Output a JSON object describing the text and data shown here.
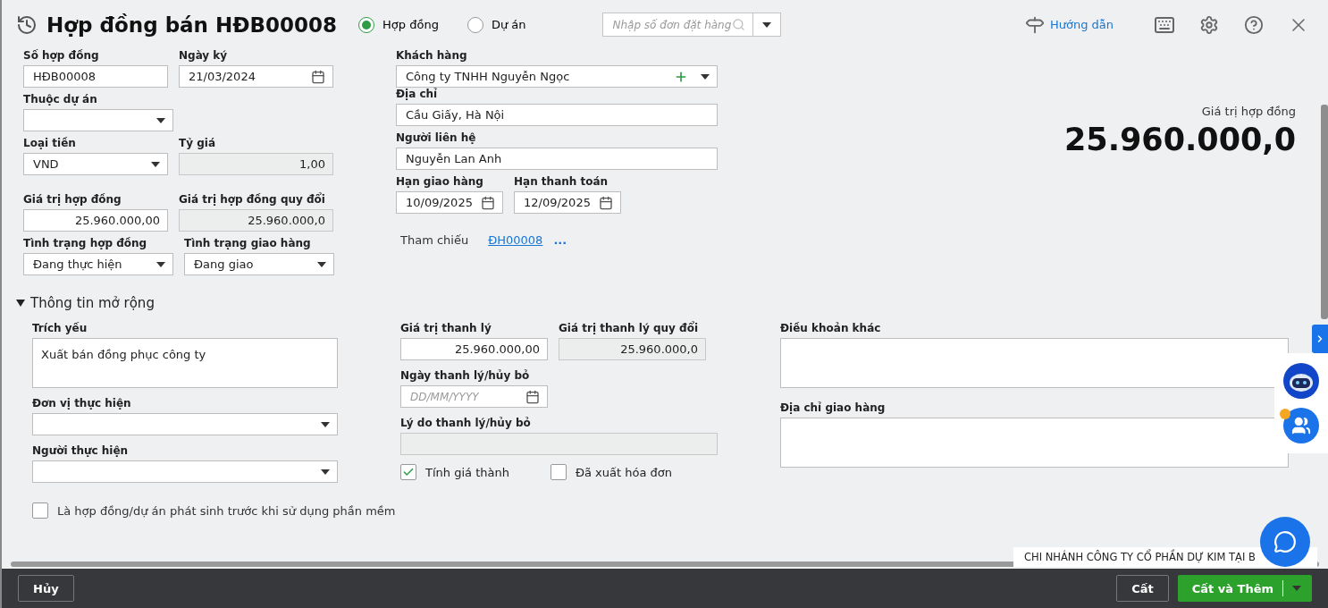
{
  "header": {
    "title": "Hợp đồng bán HĐB00008",
    "modes": [
      {
        "label": "Hợp đồng",
        "selected": true
      },
      {
        "label": "Dự án",
        "selected": false
      }
    ],
    "order_search": {
      "placeholder": "Nhập số đơn đặt hàng"
    },
    "guide_link": "Hướng dẫn"
  },
  "main_left": [
    [
      {
        "label": "Số hợp đồng",
        "value": "HĐB00008",
        "kind": "text"
      },
      {
        "label": "Ngày ký",
        "value": "21/03/2024",
        "kind": "date"
      }
    ],
    [
      {
        "label": "Thuộc dự án",
        "kind": "select"
      }
    ],
    [
      {
        "label": "Loại tiền",
        "value": "VND",
        "kind": "select"
      },
      {
        "label": "Tỷ giá",
        "value": "1,00",
        "kind": "readonly"
      }
    ],
    [
      {
        "label": "Giá trị hợp đồng",
        "value": "25.960.000,00",
        "kind": "number"
      },
      {
        "label": "Giá trị hợp đồng quy đổi",
        "value": "25.960.000,0",
        "kind": "readonly"
      }
    ],
    [
      {
        "label": "Tình trạng hợp đồng",
        "value": "Đang thực hiện",
        "kind": "select"
      },
      {
        "label": "Tình trạng giao hàng",
        "value": "Đang giao",
        "kind": "select"
      }
    ]
  ],
  "main_middle": [
    [
      {
        "label": "Khách hàng",
        "value": "Công ty TNHH Nguyễn Ngọc",
        "kind": "lookup"
      }
    ],
    [
      {
        "label": "Địa chỉ",
        "value": "Cầu Giấy, Hà Nội",
        "kind": "text"
      }
    ],
    [
      {
        "label": "Người liên hệ",
        "value": "Nguyễn Lan Anh",
        "kind": "text"
      }
    ],
    [
      {
        "label": "Hạn giao hàng",
        "value": "10/09/2025",
        "kind": "date"
      },
      {
        "label": "Hạn thanh toán",
        "value": "12/09/2025",
        "kind": "date"
      }
    ]
  ],
  "reference": {
    "label": "Tham chiếu",
    "link": "ĐH00008",
    "more": "..."
  },
  "total": {
    "label": "Giá trị hợp đồng",
    "value": "25.960.000,0"
  },
  "extended": {
    "title": "Thông tin mở rộng",
    "expanded": true,
    "left": [
      {
        "label": "Trích yếu",
        "value": "Xuất bán đồng phục công ty",
        "kind": "textarea"
      },
      {
        "label": "Đơn vị thực hiện",
        "kind": "select"
      },
      {
        "label": "Người thực hiện",
        "kind": "select"
      }
    ],
    "middle": [
      [
        {
          "label": "Giá trị thanh lý",
          "value": "25.960.000,00",
          "kind": "number"
        },
        {
          "label": "Giá trị thanh lý quy đổi",
          "value": "25.960.000,0",
          "kind": "readonly"
        }
      ],
      [
        {
          "label": "Ngày thanh lý/hủy bỏ",
          "placeholder": "DD/MM/YYYY",
          "kind": "date"
        }
      ],
      [
        {
          "label": "Lý do thanh lý/hủy bỏ",
          "kind": "readonly"
        }
      ]
    ],
    "checks": [
      {
        "label": "Tính giá thành",
        "checked": true
      },
      {
        "label": "Đã xuất hóa đơn",
        "checked": false
      }
    ],
    "right": [
      {
        "label": "Điều khoản khác",
        "kind": "textarea"
      },
      {
        "label": "Địa chỉ giao hàng",
        "kind": "textarea"
      }
    ]
  },
  "prior_use": {
    "label": "Là hợp đồng/dự án phát sinh trước khi sử dụng phần mềm",
    "checked": false
  },
  "branch": "CHI NHÁNH CÔNG TY CỔ PHẦN DỰ KIM TẠI B",
  "footer": {
    "cancel": "Hủy",
    "save": "Cất",
    "save_add": "Cất và Thêm"
  }
}
